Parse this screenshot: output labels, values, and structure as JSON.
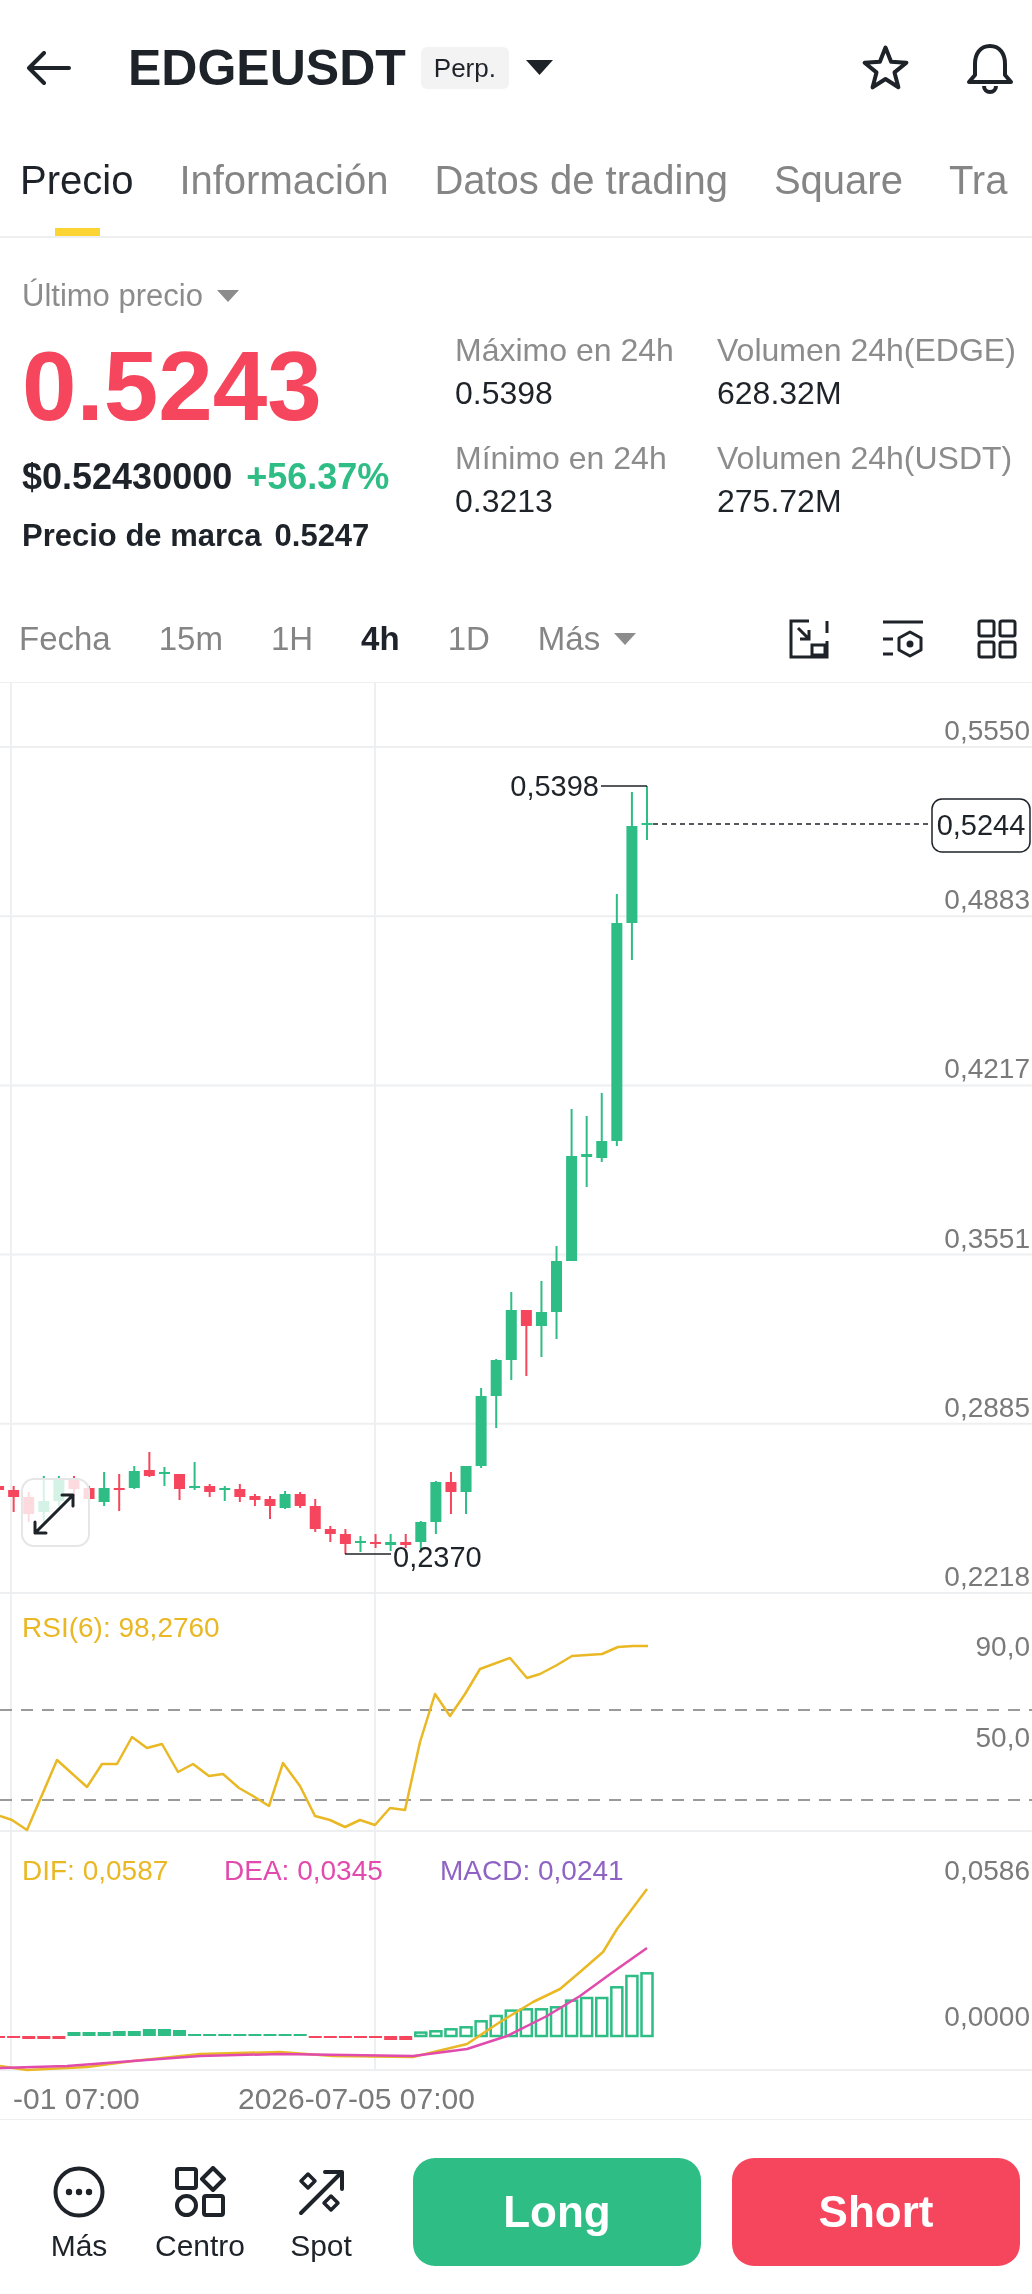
{
  "header": {
    "title": "EDGEUSDT",
    "contract_type": "Perp."
  },
  "tabs": [
    {
      "label": "Precio",
      "selected": true
    },
    {
      "label": "Información",
      "selected": false
    },
    {
      "label": "Datos de trading",
      "selected": false
    },
    {
      "label": "Square",
      "selected": false
    },
    {
      "label": "Tra",
      "selected": false
    }
  ],
  "price_summary": {
    "price_type": "Último precio",
    "last_price": "0.5243",
    "usd_price": "$0.52430000",
    "change": "+56.37%",
    "mark_price_label": "Precio de marca",
    "mark_price": "0.5247"
  },
  "stats": [
    {
      "label": "Máximo en 24h",
      "value": "0.5398"
    },
    {
      "label": "Volumen 24h(EDGE)",
      "value": "628.32M"
    },
    {
      "label": "Mínimo en 24h",
      "value": "0.3213"
    },
    {
      "label": "Volumen 24h(USDT)",
      "value": "275.72M"
    }
  ],
  "intervals": [
    {
      "label": "Fecha",
      "kind": "interval",
      "selected": false
    },
    {
      "label": "15m",
      "kind": "interval",
      "selected": false
    },
    {
      "label": "1H",
      "kind": "interval",
      "selected": false
    },
    {
      "label": "4h",
      "kind": "interval",
      "selected": true
    },
    {
      "label": "1D",
      "kind": "interval",
      "selected": false
    },
    {
      "label": "Más",
      "kind": "menu",
      "selected": false
    }
  ],
  "chart": {
    "price_axis": [
      "0,5550",
      "0,4883",
      "0,4217",
      "0,3551",
      "0,2885",
      "0,2218"
    ],
    "high_label": "0,5398",
    "low_label": "0,2370",
    "current_price": "0,5244",
    "rsi_label": "RSI(6): 98,2760",
    "rsi_axis": [
      "90,0",
      "50,0"
    ],
    "macd_legend": [
      {
        "text": "DIF: 0,0587",
        "color": "#e9b824"
      },
      {
        "text": "DEA: 0,0345",
        "color": "#e04bad"
      },
      {
        "text": "MACD: 0,0241",
        "color": "#8e63c4"
      }
    ],
    "macd_axis": [
      "0,0586",
      "0,0000"
    ],
    "time_axis": [
      "-01 07:00",
      "2026-07-05 07:00"
    ]
  },
  "bottom_bar": {
    "shortcuts": [
      {
        "label": "Más"
      },
      {
        "label": "Centro"
      },
      {
        "label": "Spot"
      }
    ],
    "actions": [
      {
        "label": "Long",
        "kind": "long"
      },
      {
        "label": "Short",
        "kind": "short"
      }
    ]
  }
}
